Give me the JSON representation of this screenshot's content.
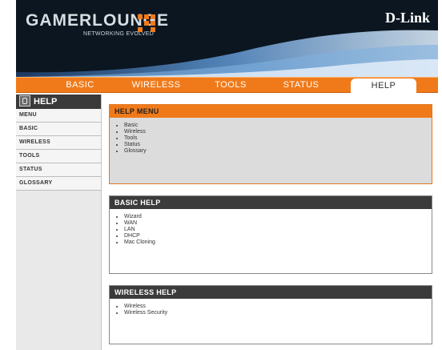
{
  "header": {
    "logo_main": "GAMERLOUNGE",
    "logo_tagline": "NETWORKING EVOLVED",
    "brand": "D-Link",
    "colors": {
      "accent": "#f07a1a",
      "header_bg": "#0b1620"
    }
  },
  "tabs": [
    {
      "label": "BASIC",
      "active": false
    },
    {
      "label": "WIRELESS",
      "active": false
    },
    {
      "label": "TOOLS",
      "active": false
    },
    {
      "label": "STATUS",
      "active": false
    },
    {
      "label": "HELP",
      "active": true
    }
  ],
  "sidebar": {
    "title": "HELP",
    "items": [
      {
        "label": "MENU"
      },
      {
        "label": "BASIC"
      },
      {
        "label": "WIRELESS"
      },
      {
        "label": "TOOLS"
      },
      {
        "label": "STATUS"
      },
      {
        "label": "GLOSSARY"
      }
    ]
  },
  "panels": {
    "help_menu": {
      "title": "HELP MENU",
      "items": [
        "Basic",
        "Wireless",
        "Tools",
        "Status",
        "Glossary"
      ]
    },
    "basic_help": {
      "title": "BASIC HELP",
      "items": [
        "Wizard",
        "WAN",
        "LAN",
        "DHCP",
        "Mac Cloning"
      ]
    },
    "wireless_help": {
      "title": "WIRELESS HELP",
      "items": [
        "Wireless",
        "Wireless Security"
      ]
    }
  }
}
